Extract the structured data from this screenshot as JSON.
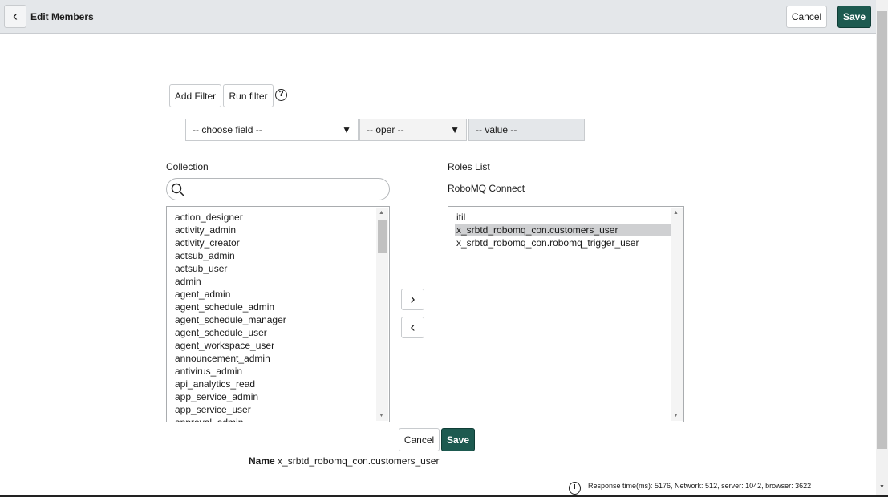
{
  "header": {
    "title": "Edit Members",
    "cancel": "Cancel",
    "save": "Save"
  },
  "filter": {
    "add_filter": "Add Filter",
    "run_filter": "Run filter",
    "field": "-- choose field --",
    "oper": "-- oper --",
    "value": "-- value --"
  },
  "collection": {
    "label": "Collection",
    "search_placeholder": "",
    "items": [
      "action_designer",
      "activity_admin",
      "activity_creator",
      "actsub_admin",
      "actsub_user",
      "admin",
      "agent_admin",
      "agent_schedule_admin",
      "agent_schedule_manager",
      "agent_schedule_user",
      "agent_workspace_user",
      "announcement_admin",
      "antivirus_admin",
      "api_analytics_read",
      "app_service_admin",
      "app_service_user",
      "approval_admin"
    ]
  },
  "roles": {
    "label": "Roles List",
    "sublabel": "RoboMQ Connect",
    "items": [
      "itil",
      "x_srbtd_robomq_con.customers_user",
      "x_srbtd_robomq_con.robomq_trigger_user"
    ],
    "selected_index": 1
  },
  "footer": {
    "cancel": "Cancel",
    "save": "Save",
    "name_label": "Name",
    "name_value": "x_srbtd_robomq_con.customers_user",
    "response": "Response time(ms): 5176, Network: 512, server: 1042, browser: 3622"
  },
  "colors": {
    "accent": "#1d5a50",
    "header_bg": "#e4e7ea"
  }
}
